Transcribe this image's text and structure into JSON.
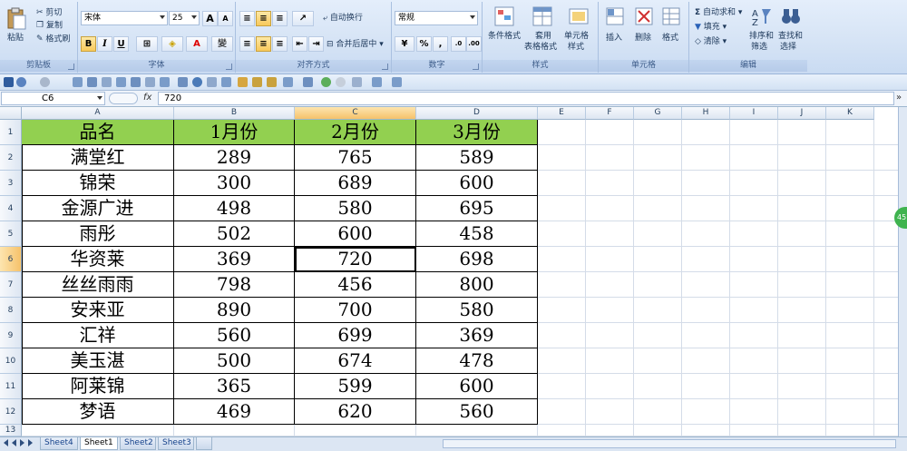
{
  "ribbon": {
    "clipboard": {
      "paste": "粘贴",
      "cut": "剪切",
      "copy": "复制",
      "format_painter": "格式刷",
      "label": "剪贴板"
    },
    "font": {
      "name": "宋体",
      "size": "25",
      "label": "字体",
      "bold": "B",
      "italic": "I",
      "underline": "U",
      "grow": "A",
      "shrink": "A",
      "phonetic": "變"
    },
    "alignment": {
      "wrap": "自动换行",
      "merge": "合并后居中",
      "label": "对齐方式"
    },
    "number": {
      "format": "常规",
      "percent": "%",
      "comma": ",",
      "label": "数字"
    },
    "styles": {
      "conditional": "条件格式",
      "table_format_1": "套用",
      "table_format_2": "表格格式",
      "cell_styles_1": "单元格",
      "cell_styles_2": "样式",
      "label": "样式"
    },
    "cells": {
      "insert": "插入",
      "delete": "删除",
      "format": "格式",
      "label": "单元格"
    },
    "editing": {
      "autosum": "自动求和",
      "fill": "填充",
      "clear": "清除",
      "sort_1": "排序和",
      "sort_2": "筛选",
      "find_1": "查找和",
      "find_2": "选择",
      "label": "编辑"
    }
  },
  "formula_bar": {
    "cell_ref": "C6",
    "fx": "fx",
    "value": "720"
  },
  "grid": {
    "columns": [
      "A",
      "B",
      "C",
      "D",
      "E",
      "F",
      "G",
      "H",
      "I",
      "J",
      "K"
    ],
    "rows": [
      "1",
      "2",
      "3",
      "4",
      "5",
      "6",
      "7",
      "8",
      "9",
      "10",
      "11",
      "12",
      "13"
    ],
    "selected_column": "C",
    "selected_row": "6",
    "header_fill": "#92d050",
    "table": {
      "headers": [
        "品名",
        "1月份",
        "2月份",
        "3月份"
      ],
      "rows": [
        [
          "满堂红",
          "289",
          "765",
          "589"
        ],
        [
          "锦荣",
          "300",
          "689",
          "600"
        ],
        [
          "金源广进",
          "498",
          "580",
          "695"
        ],
        [
          "雨彤",
          "502",
          "600",
          "458"
        ],
        [
          "华资莱",
          "369",
          "720",
          "698"
        ],
        [
          "丝丝雨雨",
          "798",
          "456",
          "800"
        ],
        [
          "安来亚",
          "890",
          "700",
          "580"
        ],
        [
          "汇祥",
          "560",
          "699",
          "369"
        ],
        [
          "美玉湛",
          "500",
          "674",
          "478"
        ],
        [
          "阿莱锦",
          "365",
          "599",
          "600"
        ],
        [
          "梦语",
          "469",
          "620",
          "560"
        ]
      ]
    }
  },
  "sheets": {
    "tabs": [
      "Sheet4",
      "Sheet1",
      "Sheet2",
      "Sheet3"
    ],
    "active": "Sheet1"
  },
  "side_badge": "45"
}
